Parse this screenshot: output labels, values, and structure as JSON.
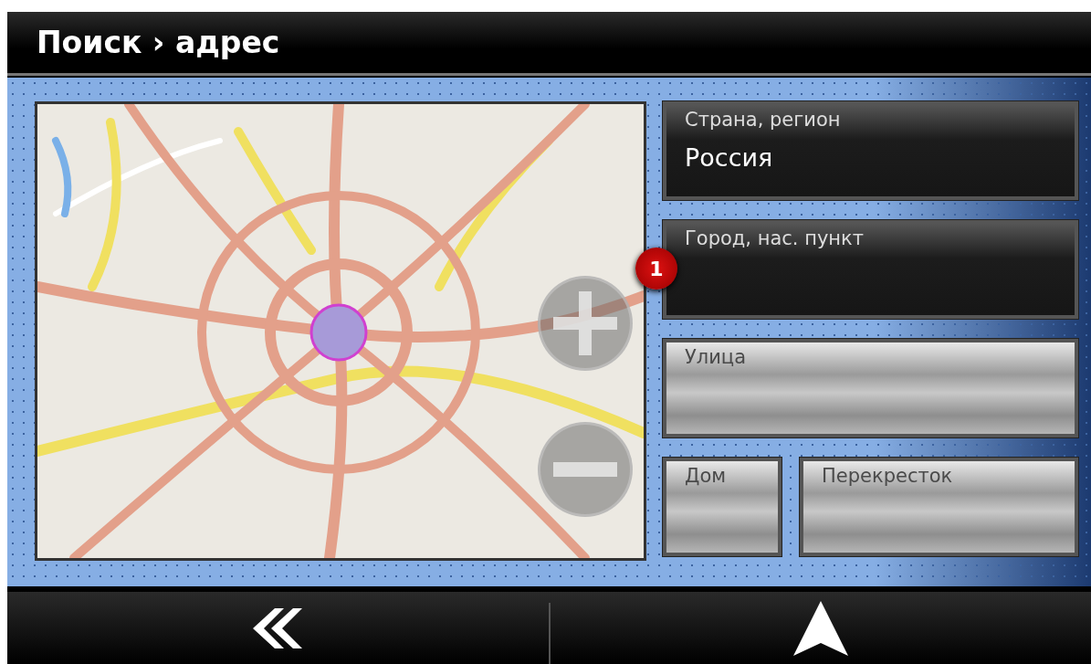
{
  "header": {
    "title": "Поиск › адрес"
  },
  "fields": [
    {
      "label": "Страна, регион",
      "value": "Россия",
      "disabled": false,
      "kind": "wide"
    },
    {
      "label": "Город, нас. пункт",
      "disabled": false,
      "kind": "wide",
      "badge": "1"
    },
    {
      "label": "Улица",
      "disabled": true,
      "kind": "wide"
    },
    {
      "label": "Дом",
      "disabled": true,
      "kind": "narrow"
    },
    {
      "label": "Перекресток",
      "disabled": true,
      "kind": "narrow"
    }
  ]
}
